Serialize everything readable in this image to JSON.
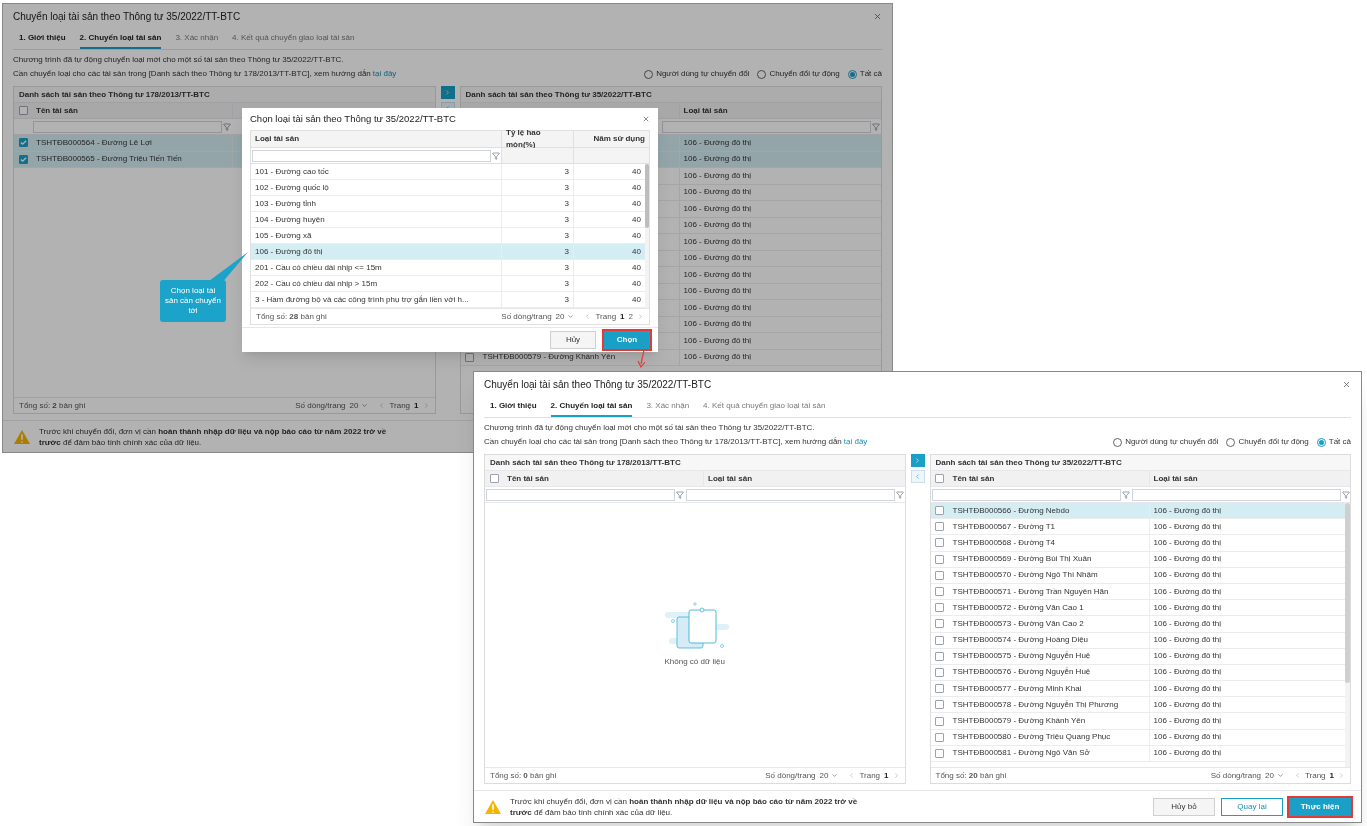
{
  "background_window": {
    "title": "Chuyển loại tài sản theo Thông tư 35/2022/TT-BTC",
    "tabs": [
      {
        "label": "1. Giới thiệu",
        "enabled": true,
        "selected": false
      },
      {
        "label": "2. Chuyển loại tài sản",
        "enabled": true,
        "selected": true
      },
      {
        "label": "3. Xác nhận",
        "enabled": false,
        "selected": false
      },
      {
        "label": "4. Kết quả chuyển giao loại tài sản",
        "enabled": false,
        "selected": false
      }
    ],
    "description": "Chương trình đã tự động chuyển loại mới cho một số tài sản theo Thông tư 35/2022/TT-BTC.",
    "guide": {
      "text": "Cần chuyển loại cho các tài sản trong [Danh sách theo Thông tư 178/2013/TT-BTC], xem hướng dẫn",
      "link": "tại đây"
    },
    "filters": [
      {
        "label": "Người dùng tự chuyển đổi",
        "selected": false
      },
      {
        "label": "Chuyển đổi tự động",
        "selected": false
      },
      {
        "label": "Tất cả",
        "selected": true
      }
    ],
    "left_panel": {
      "title": "Danh sách tài sản theo Thông tư 178/2013/TT-BTC",
      "select_all": false,
      "column_headers": {
        "name": "Tên tài sản"
      },
      "rows": [
        {
          "checked": true,
          "selected": true,
          "name": "TSHTĐB000564 - Đường Lê Lợi"
        },
        {
          "checked": true,
          "selected": true,
          "name": "TSHTĐB000565 - Đường Triệu Tiến Tiến"
        }
      ],
      "footer": {
        "total": "Tổng số: **2** bản ghi",
        "page_size_label": "Số dòng/trang",
        "page_size": "20",
        "page_label": "Trang",
        "pages": [
          {
            "label": "1",
            "selected": true
          }
        ]
      }
    },
    "right_panel": {
      "title": "Danh sách tài sản theo Thông tư 35/2022/TT-BTC",
      "column_headers": {
        "type": "Loại tài sản"
      },
      "rows": [
        {
          "selected": true,
          "type": "106 - Đường đô thị"
        },
        {
          "selected": true,
          "type": "106 - Đường đô thị"
        },
        {
          "selected": false,
          "type": "106 - Đường đô thị"
        },
        {
          "selected": false,
          "type": "106 - Đường đô thị"
        },
        {
          "selected": false,
          "type": "106 - Đường đô thị"
        },
        {
          "selected": false,
          "type": "106 - Đường đô thị"
        },
        {
          "selected": false,
          "type": "106 - Đường đô thị"
        },
        {
          "selected": false,
          "type": "106 - Đường đô thị"
        },
        {
          "selected": false,
          "type": "106 - Đường đô thị"
        },
        {
          "selected": false,
          "type": "106 - Đường đô thị"
        },
        {
          "selected": false,
          "type": "106 - Đường đô thị"
        },
        {
          "selected": false,
          "type": "106 - Đường đô thị"
        },
        {
          "selected": false,
          "type": "106 - Đường đô thị"
        },
        {
          "checked": false,
          "selected": false,
          "name": "TSHTĐB000579 - Đường Khánh Yên",
          "type": "106 - Đường đô thị"
        }
      ]
    },
    "warning": "Trước khi chuyển đổi, đơn vị cần **hoàn thành nhập dữ liệu và nộp báo cáo từ năm 2022 trở về trước** để đảm bảo tính chính xác của dữ liệu.",
    "modal": {
      "title": "Chọn loại tài sản theo Thông tư 35/2022/TT-BTC",
      "columns": [
        "Loại tài sản",
        "Tỷ lệ hao mòn(%)",
        "Năm sử dụng"
      ],
      "rows": [
        {
          "type": "101 - Đường cao tốc",
          "rate": "3",
          "years": "40",
          "selected": false
        },
        {
          "type": "102 - Đường quốc lộ",
          "rate": "3",
          "years": "40",
          "selected": false
        },
        {
          "type": "103 - Đường tỉnh",
          "rate": "3",
          "years": "40",
          "selected": false
        },
        {
          "type": "104 - Đường huyện",
          "rate": "3",
          "years": "40",
          "selected": false
        },
        {
          "type": "105 - Đường xã",
          "rate": "3",
          "years": "40",
          "selected": false
        },
        {
          "type": "106 - Đường đô thị",
          "rate": "3",
          "years": "40",
          "selected": true
        },
        {
          "type": "201 - Cầu có chiều dài nhịp <= 15m",
          "rate": "3",
          "years": "40",
          "selected": false
        },
        {
          "type": "202 - Cầu có chiều dài nhịp > 15m",
          "rate": "3",
          "years": "40",
          "selected": false
        },
        {
          "type": "3 - Hầm đường bộ và các công trình phụ trợ gắn liền với h...",
          "rate": "3",
          "years": "40",
          "selected": false
        }
      ],
      "footer": {
        "total": "Tổng số: **28** bản ghi",
        "page_size_label": "Số dòng/trang",
        "page_size": "20",
        "page_label": "Trang",
        "pages": [
          {
            "label": "1",
            "selected": true
          },
          {
            "label": "2",
            "selected": false
          }
        ]
      },
      "buttons": [
        {
          "label": "Hủy",
          "kind": "secondary",
          "highlighted": false
        },
        {
          "label": "Chọn",
          "kind": "primary",
          "highlighted": true
        }
      ]
    }
  },
  "callout": {
    "text": "Chọn loại tài sản cần chuyển tới"
  },
  "front_window": {
    "title": "Chuyển loại tài sản theo Thông tư 35/2022/TT-BTC",
    "tabs": [
      {
        "label": "1. Giới thiệu",
        "enabled": true,
        "selected": false
      },
      {
        "label": "2. Chuyển loại tài sản",
        "enabled": true,
        "selected": true
      },
      {
        "label": "3. Xác nhận",
        "enabled": false,
        "selected": false
      },
      {
        "label": "4. Kết quả chuyển giao loại tài sản",
        "enabled": false,
        "selected": false
      }
    ],
    "description": "Chương trình đã tự động chuyển loại mới cho một số tài sản theo Thông tư 35/2022/TT-BTC.",
    "guide": {
      "text": "Cần chuyển loại cho các tài sản trong [Danh sách theo Thông tư 178/2013/TT-BTC], xem hướng dẫn",
      "link": "tại đây"
    },
    "filters": [
      {
        "label": "Người dùng tự chuyển đổi",
        "selected": false
      },
      {
        "label": "Chuyển đổi tự động",
        "selected": false
      },
      {
        "label": "Tất cả",
        "selected": true
      }
    ],
    "left_panel": {
      "title": "Danh sách tài sản theo Thông tư 178/2013/TT-BTC",
      "select_all": false,
      "column_headers": {
        "name": "Tên tài sản",
        "type": "Loại tài sản"
      },
      "empty_text": "Không có dữ liệu",
      "footer": {
        "total": "Tổng số: **0** bản ghi",
        "page_size_label": "Số dòng/trang",
        "page_size": "20",
        "page_label": "Trang",
        "pages": [
          {
            "label": "1",
            "selected": true
          }
        ]
      }
    },
    "right_panel": {
      "title": "Danh sách tài sản theo Thông tư 35/2022/TT-BTC",
      "select_all": false,
      "column_headers": {
        "name": "Tên tài sản",
        "type": "Loại tài sản"
      },
      "rows": [
        {
          "checked": false,
          "selected": true,
          "name": "TSHTĐB000566 - Đường Nebdo",
          "type": "106 - Đường đô thị"
        },
        {
          "checked": false,
          "selected": false,
          "name": "TSHTĐB000567 - Đường T1",
          "type": "106 - Đường đô thị"
        },
        {
          "checked": false,
          "selected": false,
          "name": "TSHTĐB000568 - Đường T4",
          "type": "106 - Đường đô thị"
        },
        {
          "checked": false,
          "selected": false,
          "name": "TSHTĐB000569 - Đường Bùi Thị Xuân",
          "type": "106 - Đường đô thị"
        },
        {
          "checked": false,
          "selected": false,
          "name": "TSHTĐB000570 - Đường Ngô Thì Nhậm",
          "type": "106 - Đường đô thị"
        },
        {
          "checked": false,
          "selected": false,
          "name": "TSHTĐB000571 - Đường Trần Nguyên Hãn",
          "type": "106 - Đường đô thị"
        },
        {
          "checked": false,
          "selected": false,
          "name": "TSHTĐB000572 - Đường Văn Cao 1",
          "type": "106 - Đường đô thị"
        },
        {
          "checked": false,
          "selected": false,
          "name": "TSHTĐB000573 - Đường Văn Cao 2",
          "type": "106 - Đường đô thị"
        },
        {
          "checked": false,
          "selected": false,
          "name": "TSHTĐB000574 - Đường Hoàng Diệu",
          "type": "106 - Đường đô thị"
        },
        {
          "checked": false,
          "selected": false,
          "name": "TSHTĐB000575 - Đường Nguyễn Huệ",
          "type": "106 - Đường đô thị"
        },
        {
          "checked": false,
          "selected": false,
          "name": "TSHTĐB000576 - Đường Nguyễn Huệ",
          "type": "106 - Đường đô thị"
        },
        {
          "checked": false,
          "selected": false,
          "name": "TSHTĐB000577 - Đường Minh Khai",
          "type": "106 - Đường đô thị"
        },
        {
          "checked": false,
          "selected": false,
          "name": "TSHTĐB000578 - Đường Nguyễn Thị Phương",
          "type": "106 - Đường đô thị"
        },
        {
          "checked": false,
          "selected": false,
          "name": "TSHTĐB000579 - Đường Khánh Yên",
          "type": "106 - Đường đô thị"
        },
        {
          "checked": false,
          "selected": false,
          "name": "TSHTĐB000580 - Đường Triệu Quang Phục",
          "type": "106 - Đường đô thị"
        },
        {
          "checked": false,
          "selected": false,
          "name": "TSHTĐB000581 - Đường Ngô Văn Sở",
          "type": "106 - Đường đô thị"
        }
      ],
      "footer": {
        "total": "Tổng số: **20** bản ghi",
        "page_size_label": "Số dòng/trang",
        "page_size": "20",
        "page_label": "Trang",
        "pages": [
          {
            "label": "1",
            "selected": true
          }
        ]
      }
    },
    "warning": "Trước khi chuyển đổi, đơn vị cần **hoàn thành nhập dữ liệu và nộp báo cáo từ năm 2022 trở về trước** để đảm bảo tính chính xác của dữ liệu.",
    "buttons": [
      {
        "label": "Hủy bỏ",
        "kind": "secondary",
        "highlighted": false
      },
      {
        "label": "Quay lại",
        "kind": "outline",
        "highlighted": false
      },
      {
        "label": "Thực hiện",
        "kind": "primary",
        "highlighted": true
      }
    ]
  }
}
